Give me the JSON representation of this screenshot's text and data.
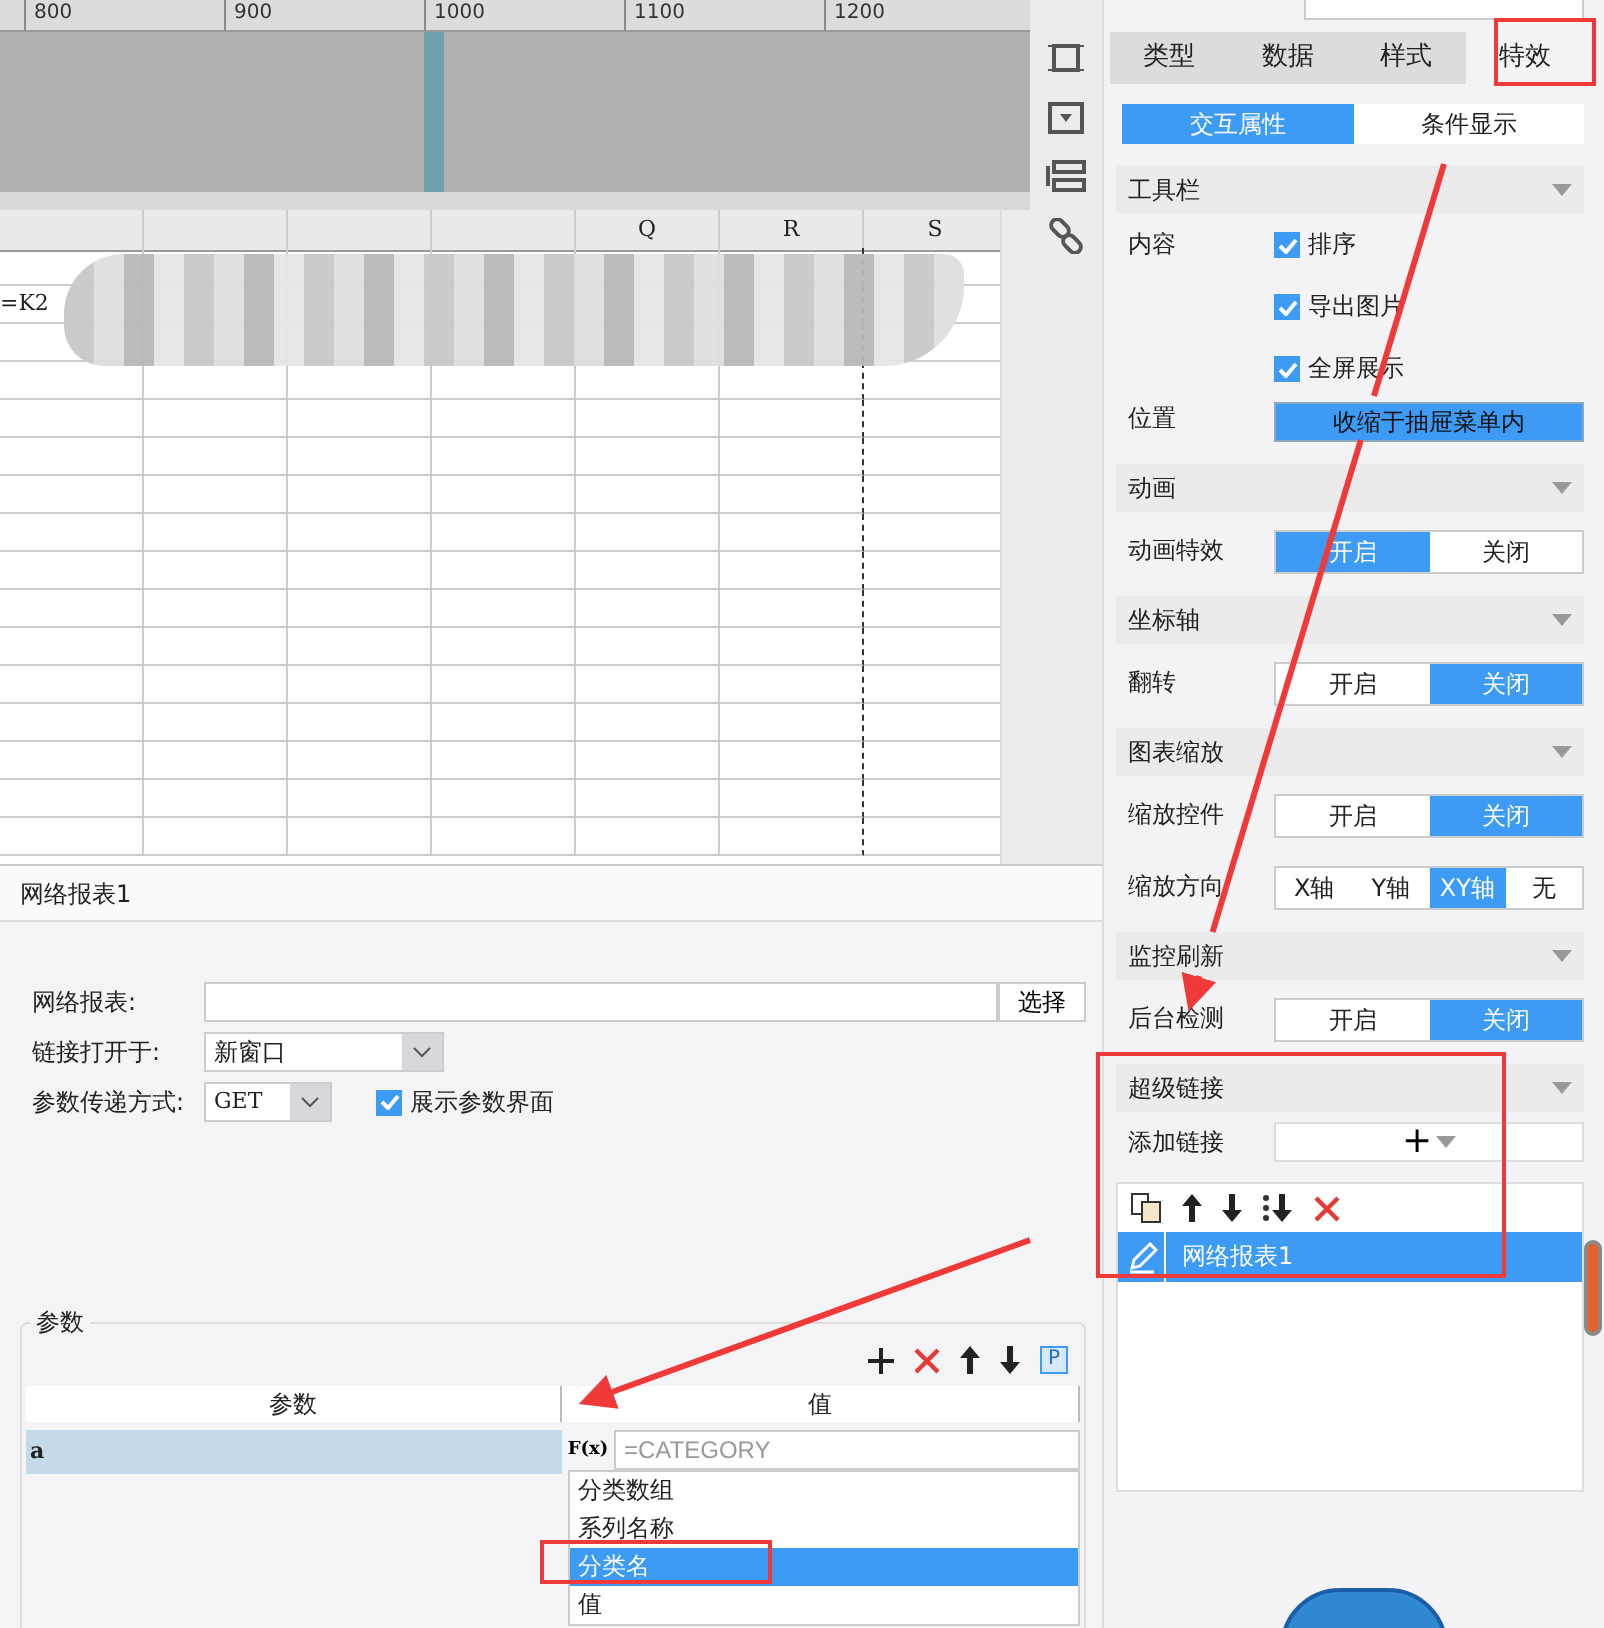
{
  "ruler": {
    "labels": [
      "800",
      "900",
      "1000",
      "1100",
      "1200"
    ]
  },
  "sheet": {
    "columns": [
      "",
      "",
      "",
      "",
      "Q",
      "R",
      "S"
    ],
    "first_cell": "=K2"
  },
  "props": {
    "tabs": [
      {
        "label": "类型",
        "selected": false
      },
      {
        "label": "数据",
        "selected": false
      },
      {
        "label": "样式",
        "selected": false
      },
      {
        "label": "特效",
        "selected": true
      }
    ],
    "subtabs": [
      {
        "label": "交互属性",
        "selected": true
      },
      {
        "label": "条件显示",
        "selected": false
      }
    ],
    "sections": [
      {
        "title": "工具栏",
        "rows": [
          {
            "kind": "checks",
            "label": "内容",
            "items": [
              {
                "label": "排序",
                "checked": true
              },
              {
                "label": "导出图片",
                "checked": true
              },
              {
                "label": "全屏展示",
                "checked": true
              }
            ]
          },
          {
            "kind": "button",
            "label": "位置",
            "value": "收缩于抽屉菜单内"
          }
        ]
      },
      {
        "title": "动画",
        "rows": [
          {
            "kind": "segments",
            "label": "动画特效",
            "options": [
              {
                "label": "开启",
                "selected": true
              },
              {
                "label": "关闭",
                "selected": false
              }
            ]
          }
        ]
      },
      {
        "title": "坐标轴",
        "rows": [
          {
            "kind": "segments",
            "label": "翻转",
            "options": [
              {
                "label": "开启",
                "selected": false
              },
              {
                "label": "关闭",
                "selected": true
              }
            ]
          }
        ]
      },
      {
        "title": "图表缩放",
        "rows": [
          {
            "kind": "segments",
            "label": "缩放控件",
            "options": [
              {
                "label": "开启",
                "selected": false
              },
              {
                "label": "关闭",
                "selected": true
              }
            ]
          },
          {
            "kind": "segments",
            "label": "缩放方向",
            "options": [
              {
                "label": "X轴",
                "selected": false
              },
              {
                "label": "Y轴",
                "selected": false
              },
              {
                "label": "XY轴",
                "selected": true
              },
              {
                "label": "无",
                "selected": false
              }
            ]
          }
        ]
      },
      {
        "title": "监控刷新",
        "rows": [
          {
            "kind": "segments",
            "label": "后台检测",
            "options": [
              {
                "label": "开启",
                "selected": false
              },
              {
                "label": "关闭",
                "selected": true
              }
            ]
          }
        ]
      },
      {
        "title": "超级链接",
        "rows": [
          {
            "kind": "add",
            "label": "添加链接",
            "value": "+"
          }
        ]
      }
    ],
    "links": [
      {
        "label": "网络报表1",
        "selected": true
      }
    ]
  },
  "dialog": {
    "title": "网络报表1",
    "report_label": "网络报表:",
    "choose_button": "选择",
    "open_label": "链接打开于:",
    "open_value": "新窗口",
    "method_label": "参数传递方式:",
    "method_value": "GET",
    "show_params": {
      "label": "展示参数界面",
      "checked": true
    },
    "params": {
      "title": "参数",
      "columns": [
        "参数",
        "值"
      ],
      "rows": [
        {
          "name": "a",
          "value": "=CATEGORY",
          "selected": true
        }
      ],
      "fx_label": "F(x)",
      "p_label": "P",
      "options": [
        {
          "label": "分类数组",
          "selected": false
        },
        {
          "label": "系列名称",
          "selected": false
        },
        {
          "label": "分类名",
          "selected": true
        },
        {
          "label": "值",
          "selected": false
        }
      ]
    }
  }
}
